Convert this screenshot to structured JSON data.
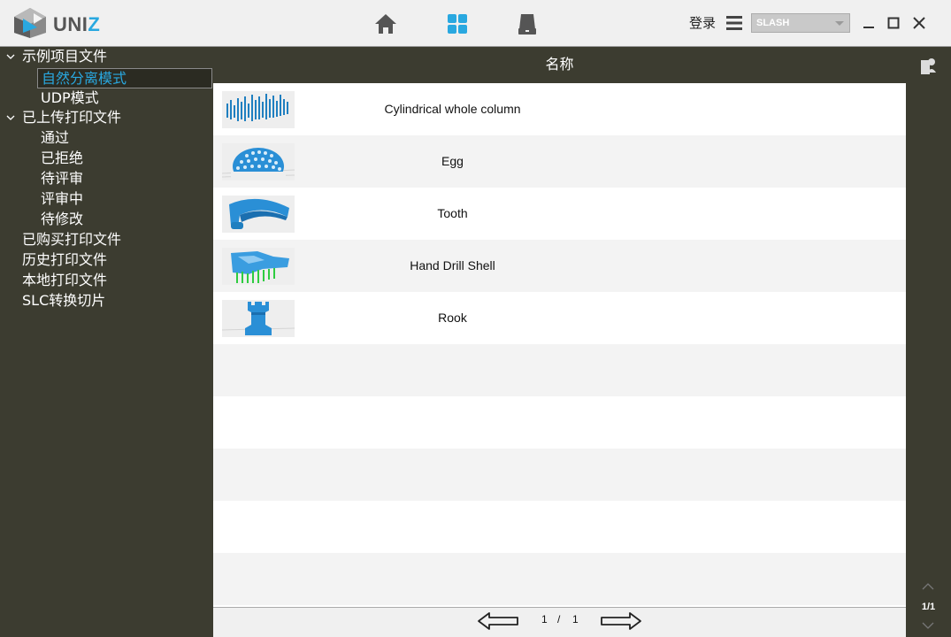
{
  "app": {
    "logo_text_a": "UNI",
    "logo_text_b": "Z"
  },
  "header": {
    "login_label": "登录",
    "printer_selected": "SLASH",
    "icons": [
      "home-icon",
      "grid-icon",
      "printer-icon",
      "menu-icon",
      "minimize-icon",
      "maximize-icon",
      "close-icon"
    ]
  },
  "sidebar": {
    "items": [
      {
        "label": "示例项目文件",
        "level": 0,
        "expanded": true
      },
      {
        "label": "自然分离模式",
        "level": 1,
        "selected": true
      },
      {
        "label": "UDP模式",
        "level": 1
      },
      {
        "label": "已上传打印文件",
        "level": 0,
        "expanded": true
      },
      {
        "label": "通过",
        "level": 1
      },
      {
        "label": "已拒绝",
        "level": 1
      },
      {
        "label": "待评审",
        "level": 1
      },
      {
        "label": "评审中",
        "level": 1
      },
      {
        "label": "待修改",
        "level": 1
      },
      {
        "label": "已购买打印文件",
        "level": 0
      },
      {
        "label": "历史打印文件",
        "level": 0
      },
      {
        "label": "本地打印文件",
        "level": 0
      },
      {
        "label": "SLC转换切片",
        "level": 0
      }
    ]
  },
  "table": {
    "column_header": "名称",
    "rows": [
      {
        "name": "Cylindrical whole column",
        "thumb": "cylinder-columns"
      },
      {
        "name": "Egg",
        "thumb": "egg-lattice"
      },
      {
        "name": "Tooth",
        "thumb": "tooth-arch"
      },
      {
        "name": "Hand Drill Shell",
        "thumb": "drill-shell"
      },
      {
        "name": "Rook",
        "thumb": "chess-rook"
      }
    ]
  },
  "pager": {
    "current": "1",
    "separator": "/",
    "total": "1"
  },
  "rightbar": {
    "page_indicator": "1/1"
  },
  "colors": {
    "sidebar_bg": "#3c3c30",
    "accent": "#29a8e0",
    "model_blue": "#1f8fd8"
  }
}
